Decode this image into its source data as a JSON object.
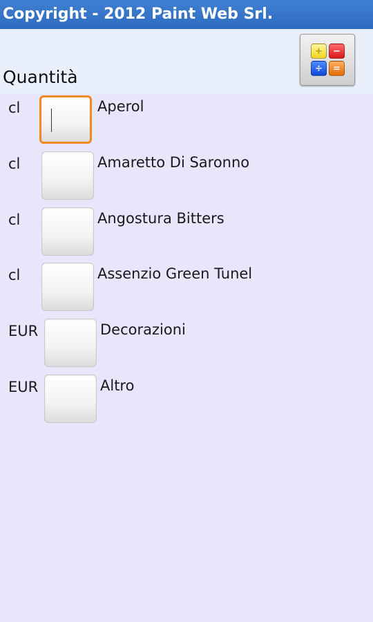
{
  "titlebar": {
    "text": "Copyright - 2012 Paint Web Srl."
  },
  "header": {
    "quantity_label": "Quantità"
  },
  "calculator": {
    "keys": [
      "+",
      "−",
      "÷",
      "="
    ]
  },
  "rows": [
    {
      "unit": "cl",
      "name": "Aperol",
      "value": ""
    },
    {
      "unit": "cl",
      "name": "Amaretto Di Saronno",
      "value": ""
    },
    {
      "unit": "cl",
      "name": "Angostura Bitters",
      "value": ""
    },
    {
      "unit": "cl",
      "name": "Assenzio Green Tunel",
      "value": ""
    },
    {
      "unit": "EUR",
      "name": "Decorazioni",
      "value": ""
    },
    {
      "unit": "EUR",
      "name": "Altro",
      "value": ""
    }
  ],
  "colors": {
    "titlebar": "#3a78cc",
    "background": "#e8e6fa",
    "header_background": "#eaf0fb",
    "focus_border": "#f08a1c"
  }
}
